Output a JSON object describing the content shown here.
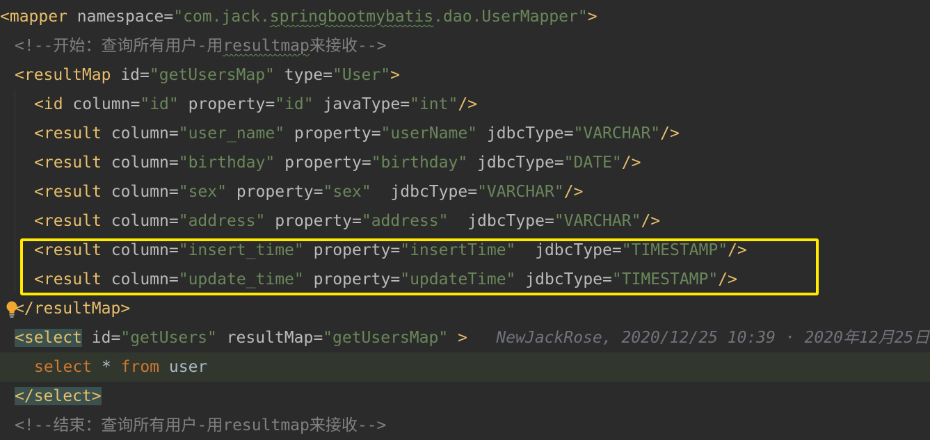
{
  "editor": {
    "lines": [
      {
        "id": "l1",
        "indent": 0,
        "tokens": [
          {
            "t": "<mapper ",
            "c": "tag"
          },
          {
            "t": "namespace",
            "c": "attr"
          },
          {
            "t": "=",
            "c": "eq"
          },
          {
            "t": "\"com.jack.",
            "c": "val"
          },
          {
            "t": "springbootmybatis",
            "c": "val wavy"
          },
          {
            "t": ".dao.UserMapper\"",
            "c": "val"
          },
          {
            "t": ">",
            "c": "tag"
          }
        ]
      },
      {
        "id": "l2",
        "indent": 1,
        "tokens": [
          {
            "t": "<!--开始：查询所有用户-用",
            "c": "cmt"
          },
          {
            "t": "resultmap",
            "c": "cmt wavy"
          },
          {
            "t": "来接收-->",
            "c": "cmt"
          }
        ]
      },
      {
        "id": "l3",
        "indent": 1,
        "tokens": [
          {
            "t": "<resultMap ",
            "c": "tag"
          },
          {
            "t": "id",
            "c": "attr"
          },
          {
            "t": "=",
            "c": "eq"
          },
          {
            "t": "\"getUsersMap\"",
            "c": "val"
          },
          {
            "t": " type",
            "c": "attr"
          },
          {
            "t": "=",
            "c": "eq"
          },
          {
            "t": "\"User\"",
            "c": "val"
          },
          {
            "t": ">",
            "c": "tag"
          }
        ]
      },
      {
        "id": "l4",
        "indent": 2,
        "tokens": [
          {
            "t": "<id ",
            "c": "tag"
          },
          {
            "t": "column",
            "c": "attr"
          },
          {
            "t": "=",
            "c": "eq"
          },
          {
            "t": "\"id\"",
            "c": "val"
          },
          {
            "t": " property",
            "c": "attr"
          },
          {
            "t": "=",
            "c": "eq"
          },
          {
            "t": "\"id\"",
            "c": "val"
          },
          {
            "t": " javaType",
            "c": "attr"
          },
          {
            "t": "=",
            "c": "eq"
          },
          {
            "t": "\"int\"",
            "c": "val"
          },
          {
            "t": "/>",
            "c": "tag"
          }
        ]
      },
      {
        "id": "l5",
        "indent": 2,
        "tokens": [
          {
            "t": "<result ",
            "c": "tag"
          },
          {
            "t": "column",
            "c": "attr"
          },
          {
            "t": "=",
            "c": "eq"
          },
          {
            "t": "\"user_name\"",
            "c": "val"
          },
          {
            "t": " property",
            "c": "attr"
          },
          {
            "t": "=",
            "c": "eq"
          },
          {
            "t": "\"userName\"",
            "c": "val"
          },
          {
            "t": " jdbcType",
            "c": "attr"
          },
          {
            "t": "=",
            "c": "eq"
          },
          {
            "t": "\"VARCHAR\"",
            "c": "val"
          },
          {
            "t": "/>",
            "c": "tag"
          }
        ]
      },
      {
        "id": "l6",
        "indent": 2,
        "tokens": [
          {
            "t": "<result ",
            "c": "tag"
          },
          {
            "t": "column",
            "c": "attr"
          },
          {
            "t": "=",
            "c": "eq"
          },
          {
            "t": "\"birthday\"",
            "c": "val"
          },
          {
            "t": " property",
            "c": "attr"
          },
          {
            "t": "=",
            "c": "eq"
          },
          {
            "t": "\"birthday\"",
            "c": "val"
          },
          {
            "t": " jdbcType",
            "c": "attr"
          },
          {
            "t": "=",
            "c": "eq"
          },
          {
            "t": "\"DATE\"",
            "c": "val"
          },
          {
            "t": "/>",
            "c": "tag"
          }
        ]
      },
      {
        "id": "l7",
        "indent": 2,
        "tokens": [
          {
            "t": "<result ",
            "c": "tag"
          },
          {
            "t": "column",
            "c": "attr"
          },
          {
            "t": "=",
            "c": "eq"
          },
          {
            "t": "\"sex\"",
            "c": "val"
          },
          {
            "t": " property",
            "c": "attr"
          },
          {
            "t": "=",
            "c": "eq"
          },
          {
            "t": "\"sex\"",
            "c": "val"
          },
          {
            "t": "  jdbcType",
            "c": "attr"
          },
          {
            "t": "=",
            "c": "eq"
          },
          {
            "t": "\"VARCHAR\"",
            "c": "val"
          },
          {
            "t": "/>",
            "c": "tag"
          }
        ]
      },
      {
        "id": "l8",
        "indent": 2,
        "tokens": [
          {
            "t": "<result ",
            "c": "tag"
          },
          {
            "t": "column",
            "c": "attr"
          },
          {
            "t": "=",
            "c": "eq"
          },
          {
            "t": "\"address\"",
            "c": "val"
          },
          {
            "t": " property",
            "c": "attr"
          },
          {
            "t": "=",
            "c": "eq"
          },
          {
            "t": "\"address\"",
            "c": "val"
          },
          {
            "t": "  jdbcType",
            "c": "attr"
          },
          {
            "t": "=",
            "c": "eq"
          },
          {
            "t": "\"VARCHAR\"",
            "c": "val"
          },
          {
            "t": "/>",
            "c": "tag"
          }
        ]
      },
      {
        "id": "l9",
        "indent": 2,
        "tokens": [
          {
            "t": "<result ",
            "c": "tag"
          },
          {
            "t": "column",
            "c": "attr"
          },
          {
            "t": "=",
            "c": "eq"
          },
          {
            "t": "\"insert_time\"",
            "c": "val"
          },
          {
            "t": " property",
            "c": "attr"
          },
          {
            "t": "=",
            "c": "eq"
          },
          {
            "t": "\"insertTime\"",
            "c": "val"
          },
          {
            "t": "  jdbcType",
            "c": "attr"
          },
          {
            "t": "=",
            "c": "eq"
          },
          {
            "t": "\"TIMESTAMP\"",
            "c": "val"
          },
          {
            "t": "/>",
            "c": "tag"
          }
        ]
      },
      {
        "id": "l10",
        "indent": 2,
        "tokens": [
          {
            "t": "<result ",
            "c": "tag"
          },
          {
            "t": "column",
            "c": "attr"
          },
          {
            "t": "=",
            "c": "eq"
          },
          {
            "t": "\"update_time\"",
            "c": "val"
          },
          {
            "t": " property",
            "c": "attr"
          },
          {
            "t": "=",
            "c": "eq"
          },
          {
            "t": "\"updateTime\"",
            "c": "val"
          },
          {
            "t": " jdbcType",
            "c": "attr"
          },
          {
            "t": "=",
            "c": "eq"
          },
          {
            "t": "\"TIMESTAMP\"",
            "c": "val"
          },
          {
            "t": "/>",
            "c": "tag"
          }
        ]
      },
      {
        "id": "l11",
        "indent": 1,
        "tokens": [
          {
            "t": "</resultMap>",
            "c": "tag"
          }
        ]
      },
      {
        "id": "l12",
        "indent": 1,
        "tokens": [
          {
            "t": "<select",
            "c": "tag-hl"
          },
          {
            "t": " id",
            "c": "attr"
          },
          {
            "t": "=",
            "c": "eq"
          },
          {
            "t": "\"getUsers\"",
            "c": "val"
          },
          {
            "t": " resultMap",
            "c": "attr"
          },
          {
            "t": "=",
            "c": "eq"
          },
          {
            "t": "\"getUsersMap\"",
            "c": "val"
          },
          {
            "t": " >",
            "c": "tag"
          },
          {
            "t": "   NewJackRose, 2020/12/25 10:39 · 2020年12月25日",
            "c": "annotation"
          }
        ]
      },
      {
        "id": "l13",
        "indent": 2,
        "highlight": true,
        "tokens": [
          {
            "t": "select ",
            "c": "kw"
          },
          {
            "t": "* ",
            "c": "plain"
          },
          {
            "t": "from ",
            "c": "kw"
          },
          {
            "t": "user",
            "c": "plain"
          }
        ]
      },
      {
        "id": "l14",
        "indent": 1,
        "tokens": [
          {
            "t": "</select>",
            "c": "tag-hl"
          }
        ]
      },
      {
        "id": "l15",
        "indent": 1,
        "tokens": [
          {
            "t": "<!--结束：查询所有用户-用resultmap来接收-->",
            "c": "cmt"
          }
        ]
      }
    ],
    "highlight_box_color": "#ffea00",
    "intention_bulb": "lightbulb-icon"
  }
}
